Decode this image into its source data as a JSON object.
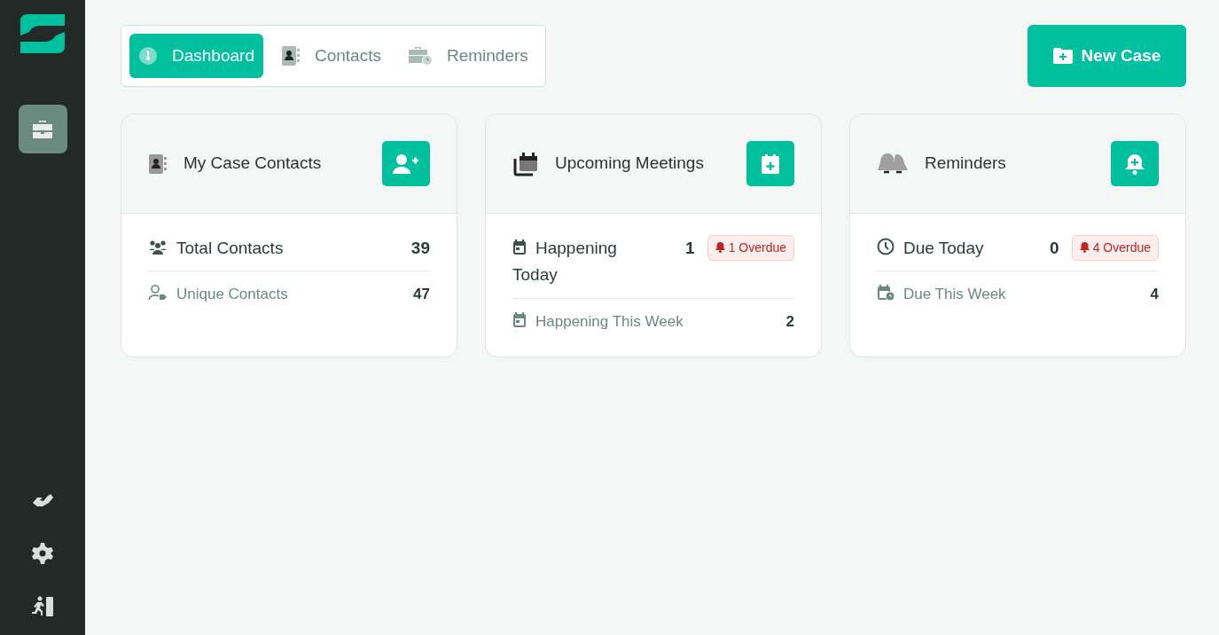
{
  "sidebar": {
    "items": [
      {
        "selected": true
      }
    ]
  },
  "tabs": [
    {
      "label": "Dashboard",
      "selected": true
    },
    {
      "label": "Contacts",
      "selected": false
    },
    {
      "label": "Reminders",
      "selected": false
    }
  ],
  "new_case_button": {
    "label": "New Case"
  },
  "cards": [
    {
      "title": "My Case Contacts",
      "rows": [
        {
          "kind": "primary",
          "label": "Total Contacts",
          "value": "39"
        },
        {
          "kind": "secondary",
          "label": "Unique Contacts",
          "value": "47"
        }
      ]
    },
    {
      "title": "Upcoming Meetings",
      "rows": [
        {
          "kind": "primary",
          "label": "Happening Today",
          "value": "1",
          "badge": "1 Overdue"
        },
        {
          "kind": "secondary",
          "label": "Happening This Week",
          "value": "2"
        }
      ]
    },
    {
      "title": "Reminders",
      "rows": [
        {
          "kind": "primary",
          "label": "Due Today",
          "value": "0",
          "badge": "4 Overdue"
        },
        {
          "kind": "secondary",
          "label": "Due This Week",
          "value": "4"
        }
      ]
    }
  ]
}
